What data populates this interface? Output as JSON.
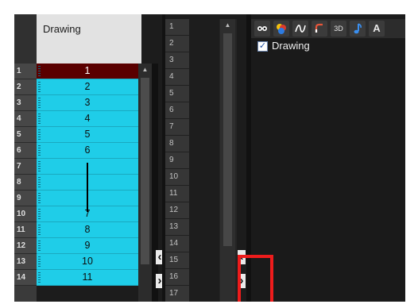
{
  "xsheet": {
    "column_name": "Drawing",
    "row_numbers": [
      "1",
      "2",
      "3",
      "4",
      "5",
      "6",
      "7",
      "8",
      "9",
      "10",
      "11",
      "12",
      "13",
      "14"
    ],
    "cells": [
      "1",
      "2",
      "3",
      "4",
      "5",
      "6",
      "",
      "",
      "",
      "7",
      "8",
      "9",
      "10",
      "11"
    ],
    "selected_row": "1"
  },
  "timeline": {
    "frame_numbers": [
      "1",
      "2",
      "3",
      "4",
      "5",
      "6",
      "7",
      "8",
      "9",
      "10",
      "11",
      "12",
      "13",
      "14",
      "15",
      "16",
      "17"
    ]
  },
  "layers": {
    "toolbar_icons": [
      "eyes-icon",
      "color-icon",
      "curve-icon",
      "brush-icon",
      "3d-icon",
      "sound-icon",
      "text-icon"
    ],
    "toolbar_labels": {
      "three_d": "3D",
      "text": "A"
    },
    "items": [
      {
        "name": "Drawing",
        "checked": true
      }
    ]
  },
  "colors": {
    "cell_fill": "#1fcde8",
    "selected_cell": "#5a0000",
    "highlight": "#ee1c1c"
  }
}
